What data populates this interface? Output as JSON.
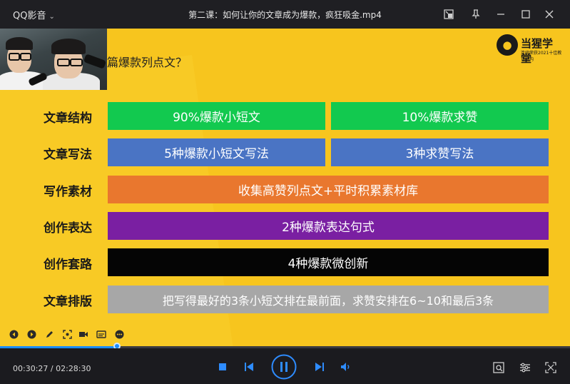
{
  "titlebar": {
    "app_name": "QQ影音",
    "file_title": "第二课：如何让你的文章成为爆款，疯狂吸金.mp4"
  },
  "slide": {
    "question_fragment": "篇爆款列点文？",
    "logo_name": "当猩学堂",
    "logo_sub": "连续荣获2021十佳教育机构",
    "rows": [
      {
        "label": "文章结构",
        "cells": [
          {
            "text": "90%爆款小短文",
            "color": "#12c94f"
          },
          {
            "text": "10%爆款求赞",
            "color": "#12c94f"
          }
        ]
      },
      {
        "label": "文章写法",
        "cells": [
          {
            "text": "5种爆款小短文写法",
            "color": "#4a74c4"
          },
          {
            "text": "3种求赞写法",
            "color": "#4a74c4"
          }
        ]
      },
      {
        "label": "写作素材",
        "cells": [
          {
            "text": "收集高赞列点文+平时积累素材库",
            "color": "#e9772e"
          }
        ]
      },
      {
        "label": "创作表达",
        "cells": [
          {
            "text": "2种爆款表达句式",
            "color": "#7a1fa2"
          }
        ]
      },
      {
        "label": "创作套路",
        "cells": [
          {
            "text": "4种爆款微创新",
            "color": "#050505"
          }
        ]
      },
      {
        "label": "文章排版",
        "cells": [
          {
            "text": "把写得最好的3条小短文排在最前面，求赞安排在6~10和最后3条",
            "color": "#a7a7a7"
          }
        ]
      }
    ]
  },
  "player": {
    "current_time": "00:30:27",
    "total_time": "02:28:30",
    "progress": 0.205
  }
}
